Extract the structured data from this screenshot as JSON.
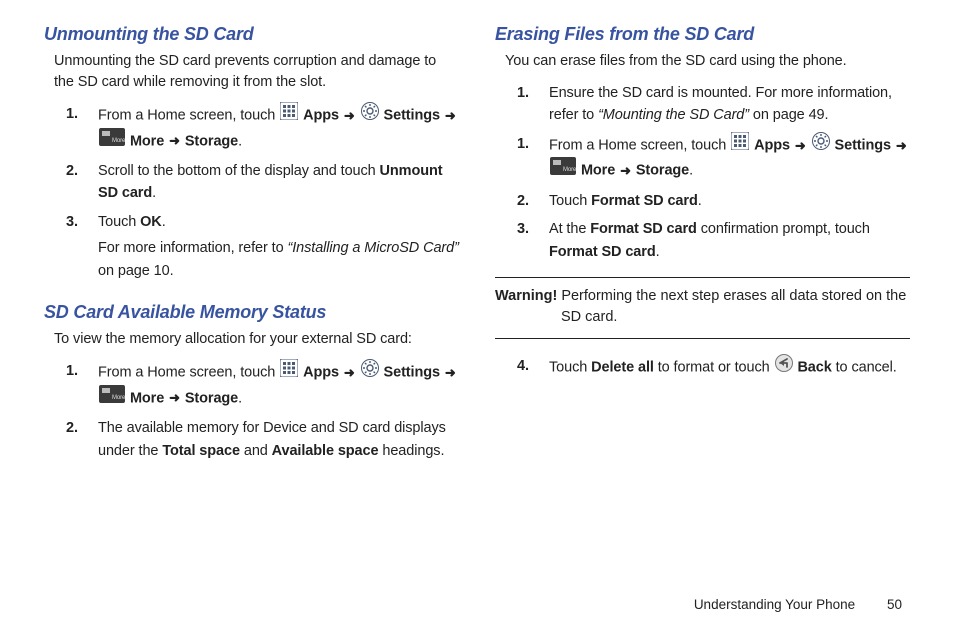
{
  "left": {
    "section1": {
      "heading": "Unmounting the SD Card",
      "intro": "Unmounting the SD card prevents corruption and damage to the SD card while removing it from the slot.",
      "step1_a": "From a Home screen, touch ",
      "apps": "Apps",
      "settings": "Settings",
      "more": "More",
      "storage": "Storage",
      "step2_a": "Scroll to the bottom of the display and touch ",
      "step2_b": "Unmount SD card",
      "step3_a": "Touch ",
      "step3_b": "OK",
      "step3_sub_a": "For more information, refer to ",
      "step3_sub_b": "“Installing a MicroSD Card”",
      "step3_sub_c": " on page 10."
    },
    "section2": {
      "heading": "SD Card Available Memory Status",
      "intro": "To view the memory allocation for your external SD card:",
      "step1_a": "From a Home screen, touch ",
      "apps": "Apps",
      "settings": "Settings",
      "more": "More",
      "storage": "Storage",
      "step2_a": "The available memory for Device and SD card displays under the ",
      "step2_b": "Total space",
      "step2_c": " and ",
      "step2_d": "Available space",
      "step2_e": " headings."
    }
  },
  "right": {
    "section1": {
      "heading": "Erasing Files from the SD Card",
      "intro": "You can erase files from the SD card using the phone.",
      "step1_a": "Ensure the SD card is mounted. For more information, refer to ",
      "step1_b": "“Mounting the SD Card”",
      "step1_c": " on page 49.",
      "step2_a": "From a Home screen, touch ",
      "apps": "Apps",
      "settings": "Settings",
      "more": "More",
      "storage": "Storage",
      "step3_a": "Touch ",
      "step3_b": "Format SD card",
      "step4_a": "At the ",
      "step4_b": "Format SD card",
      "step4_c": " confirmation prompt, touch ",
      "step4_d": "Format SD card",
      "warning_a": "Warning!",
      "warning_b": " Performing the next step erases all data stored on the SD card.",
      "step5_a": "Touch ",
      "step5_b": "Delete all",
      "step5_c": " to format or touch ",
      "step5_d": "Back",
      "step5_e": " to cancel."
    }
  },
  "footer": {
    "text": "Understanding Your Phone",
    "page": "50"
  },
  "arrow": "➜",
  "period": "."
}
